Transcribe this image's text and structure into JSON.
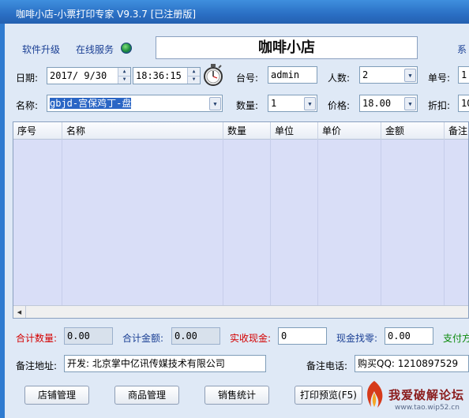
{
  "window": {
    "title": "咖啡小店-小票打印专家 V9.3.7 [已注册版]"
  },
  "top_links": {
    "upgrade": "软件升级",
    "online": "在线服务",
    "settings_partial": "系"
  },
  "shop_name": "咖啡小店",
  "date_row": {
    "date_label": "日期:",
    "date_value": "2017/ 9/30",
    "time_value": "18:36:15",
    "table_label": "台号:",
    "table_value": "admin",
    "people_label": "人数:",
    "people_value": "2",
    "order_label": "单号:",
    "order_value": "1"
  },
  "item_row": {
    "name_label": "名称:",
    "name_value": "gbjd-宫保鸡丁-盘",
    "qty_label": "数量:",
    "qty_value": "1",
    "price_label": "价格:",
    "price_value": "18.00",
    "discount_label": "折扣:",
    "discount_value": "10"
  },
  "table": {
    "columns": [
      "序号",
      "名称",
      "数量",
      "单位",
      "单价",
      "金额",
      "备注"
    ],
    "rows": []
  },
  "totals": {
    "total_qty_label": "合计数量:",
    "total_qty_value": "0.00",
    "total_amount_label": "合计金额:",
    "total_amount_value": "0.00",
    "cash_received_label": "实收现金:",
    "cash_received_value": "0",
    "change_label": "现金找零:",
    "change_value": "0.00",
    "pay_method_partial": "支付方"
  },
  "notes": {
    "address_label": "备注地址:",
    "address_value": "开发: 北京掌中亿讯传媒技术有限公司",
    "phone_label": "备注电话:",
    "phone_value": "购买QQ: 1210897529"
  },
  "buttons": {
    "store_mgmt": "店铺管理",
    "product_mgmt": "商品管理",
    "sales_stats": "销售统计",
    "print_preview": "打印预览(F5)"
  },
  "watermark": {
    "text": "我爱破解论坛",
    "url": "www.tao.wip52.cn"
  },
  "colors": {
    "titlebar": "#2a6fc4",
    "frame": "#dfe9f6",
    "grid": "#d9def7",
    "red_label": "#d40000",
    "blue_label": "#1a3f94",
    "green_label": "#0a8a0a"
  },
  "icons": [
    "globe-icon",
    "stopwatch-icon",
    "spin-up-icon",
    "spin-down-icon",
    "dropdown-arrow-icon",
    "scroll-left-icon"
  ]
}
